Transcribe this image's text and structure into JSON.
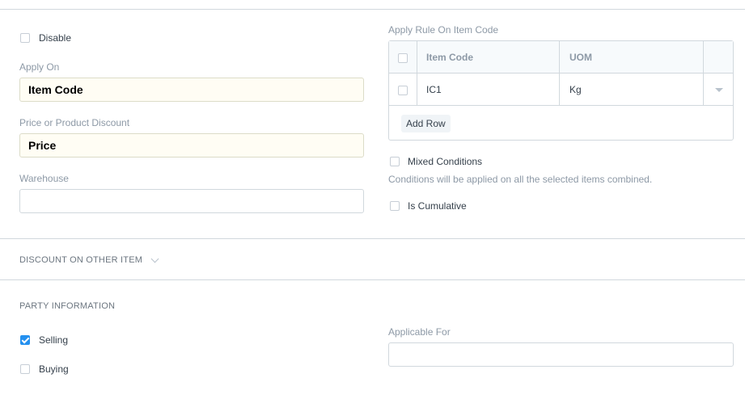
{
  "left": {
    "disable_label": "Disable",
    "apply_on_label": "Apply On",
    "apply_on_value": "Item Code",
    "price_discount_label": "Price or Product Discount",
    "price_discount_value": "Price",
    "warehouse_label": "Warehouse",
    "warehouse_value": ""
  },
  "right": {
    "apply_rule_label": "Apply Rule On Item Code",
    "grid": {
      "columns": [
        "Item Code",
        "UOM"
      ],
      "rows": [
        {
          "item_code": "IC1",
          "uom": "Kg"
        }
      ],
      "add_row_label": "Add Row"
    },
    "mixed_conditions_label": "Mixed Conditions",
    "mixed_conditions_help": "Conditions will be applied on all the selected items combined.",
    "is_cumulative_label": "Is Cumulative"
  },
  "sections": {
    "discount_other_item": "DISCOUNT ON OTHER ITEM",
    "party_information": "PARTY INFORMATION"
  },
  "party": {
    "selling_label": "Selling",
    "selling_checked": true,
    "buying_label": "Buying",
    "buying_checked": false,
    "applicable_for_label": "Applicable For",
    "applicable_for_value": ""
  }
}
